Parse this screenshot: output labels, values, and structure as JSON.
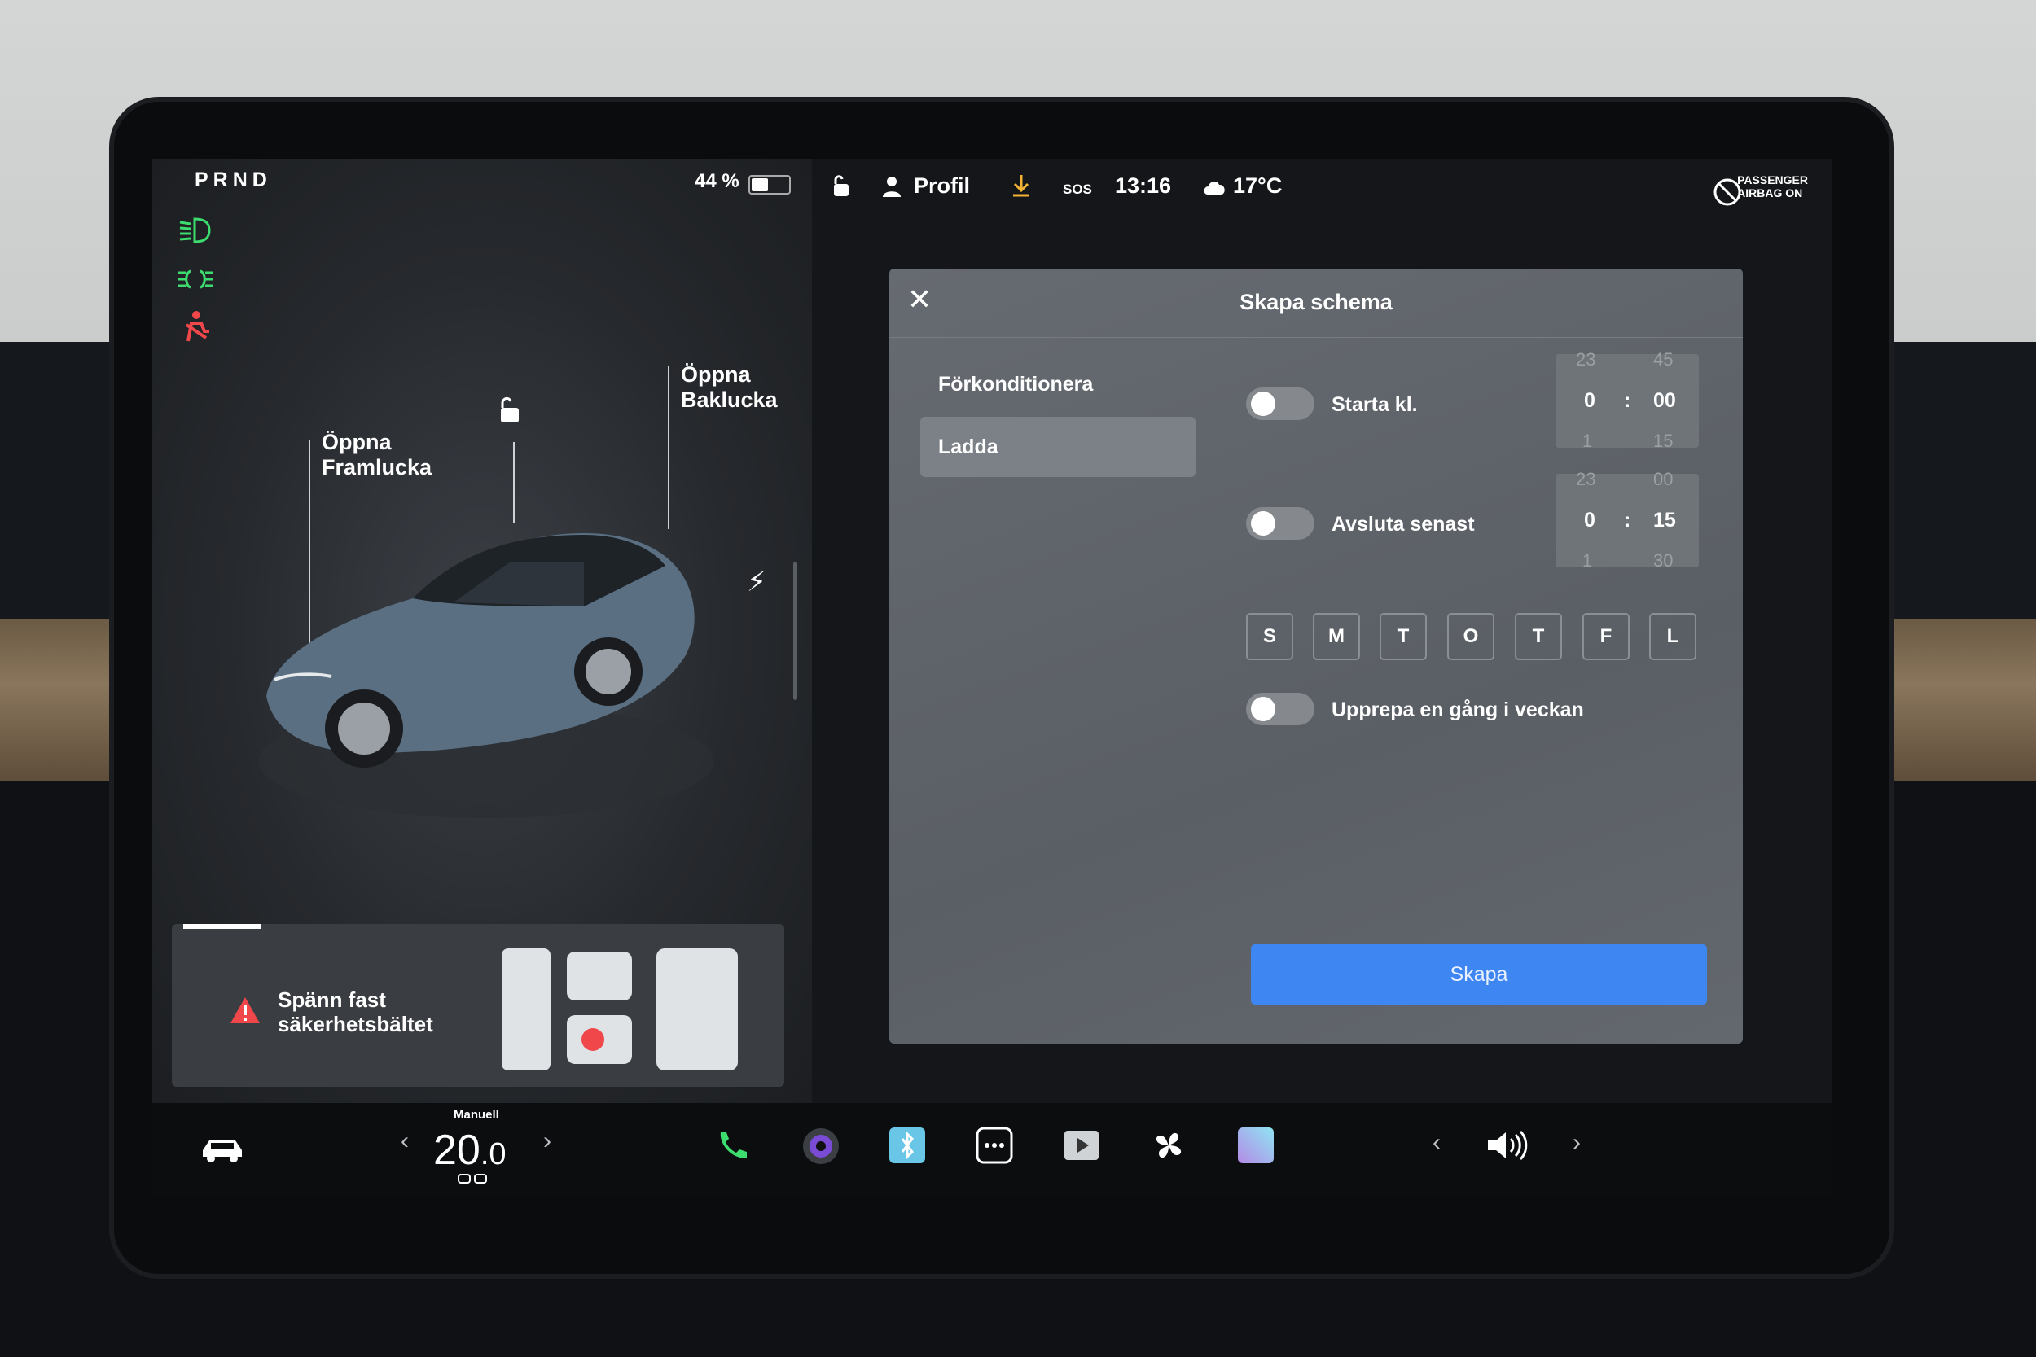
{
  "status": {
    "gear": "PRND",
    "battery": "44 %",
    "profile": "Profil",
    "time": "13:16",
    "sos": "SOS",
    "temperature": "17°C",
    "airbag_line1": "PASSENGER",
    "airbag_line2": "AIRBAG ON",
    "battery_level": 0.44
  },
  "car": {
    "front_trunk": "Öppna\nFramlucka",
    "front_trunk_l1": "Öppna",
    "front_trunk_l2": "Framlucka",
    "rear_trunk_l1": "Öppna",
    "rear_trunk_l2": "Baklucka"
  },
  "seatbelt": {
    "line1": "Spänn fast",
    "line2": "säkerhetsbältet"
  },
  "modal": {
    "title": "Skapa schema",
    "tabs": [
      "Förkonditionera",
      "Ladda"
    ],
    "active_tab": "Ladda",
    "start": {
      "label": "Starta kl.",
      "above_h": "23",
      "above_m": "45",
      "hour": "0",
      "sep": ":",
      "minute": "00",
      "below_h": "1",
      "below_m": "15",
      "enabled": false
    },
    "end": {
      "label": "Avsluta senast",
      "above_h": "23",
      "above_m": "00",
      "hour": "0",
      "sep": ":",
      "minute": "15",
      "below_h": "1",
      "below_m": "30",
      "enabled": false
    },
    "days": [
      "S",
      "M",
      "T",
      "O",
      "T",
      "F",
      "L"
    ],
    "repeat": {
      "label": "Upprepa en gång i veckan",
      "enabled": false
    },
    "create_label": "Skapa"
  },
  "dock": {
    "temp_mode": "Manuell",
    "temp_whole": "20",
    "temp_dec": ".0",
    "icons": [
      "car-icon",
      "phone-icon",
      "camera-icon",
      "bluetooth-app-icon",
      "more-icon",
      "video-icon",
      "fan-icon",
      "app-icon",
      "volume-icon"
    ]
  },
  "colors": {
    "accent": "#3e86f2",
    "light_green": "#3ddc6e",
    "warning_red": "#f0484a"
  }
}
